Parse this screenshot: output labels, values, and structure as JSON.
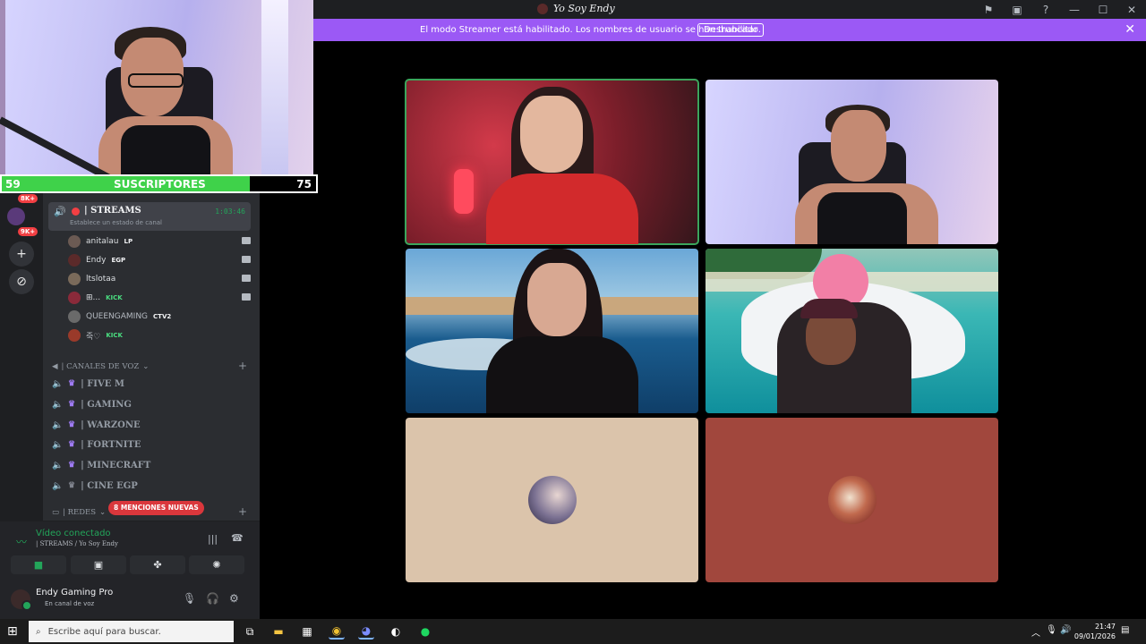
{
  "window": {
    "title": "Yo Soy Endy"
  },
  "banner": {
    "message": "El modo Streamer está habilitado. Los nombres de usuario se han truncado.",
    "button": "Deshabilitar",
    "close": "✕"
  },
  "overlay": {
    "subs_current": "59",
    "subs_label": "SUSCRIPTORES",
    "subs_goal": "75",
    "progress": 0.79
  },
  "rail": {
    "badges": [
      "8K+",
      "9K+"
    ]
  },
  "voice_channel": {
    "name": "| STREAMS",
    "status": "Establece un estado de canal",
    "timer": "1:03:46",
    "members": [
      {
        "name": "anitalau",
        "tag": "LP",
        "tag_icon": "rocket-icon",
        "camera": true
      },
      {
        "name": "Endy",
        "tag": "EGP",
        "tag_icon": "flame-icon",
        "camera": true
      },
      {
        "name": "ltslotaa",
        "tag": "",
        "tag_icon": "",
        "camera": true
      },
      {
        "name": "⊞...",
        "tag": "KICK",
        "tag_icon": "heart-icon",
        "camera": true
      },
      {
        "name": "QUEENGAMING",
        "tag": "CTV2",
        "tag_icon": "flame-icon",
        "camera": false
      },
      {
        "name": "죽♡",
        "tag": "KICK",
        "tag_icon": "heart-icon",
        "camera": false
      }
    ]
  },
  "categories": {
    "voice": "| CANALES DE VOZ",
    "redes": "| REDES",
    "mentions": "8 MENCIONES NUEVAS"
  },
  "channels": [
    {
      "name": "| FIVE M"
    },
    {
      "name": "| GAMING"
    },
    {
      "name": "| WARZONE"
    },
    {
      "name": "| FORTNITE"
    },
    {
      "name": "| MINECRAFT"
    },
    {
      "name": "| CINE EGP"
    }
  ],
  "connection": {
    "title": "Vídeo conectado",
    "subtitle": "| STREAMS / Yo Soy Endy"
  },
  "user": {
    "name": "Endy Gaming Pro",
    "status": "En canal de voz"
  },
  "taskbar": {
    "search_placeholder": "Escribe aquí para buscar.",
    "time": "21:47",
    "date": "09/01/2026"
  },
  "colors": {
    "accent_banner": "#9b59f5",
    "connected_green": "#23a55a",
    "sidebar": "#2b2d31",
    "mention_red": "#da373c"
  }
}
